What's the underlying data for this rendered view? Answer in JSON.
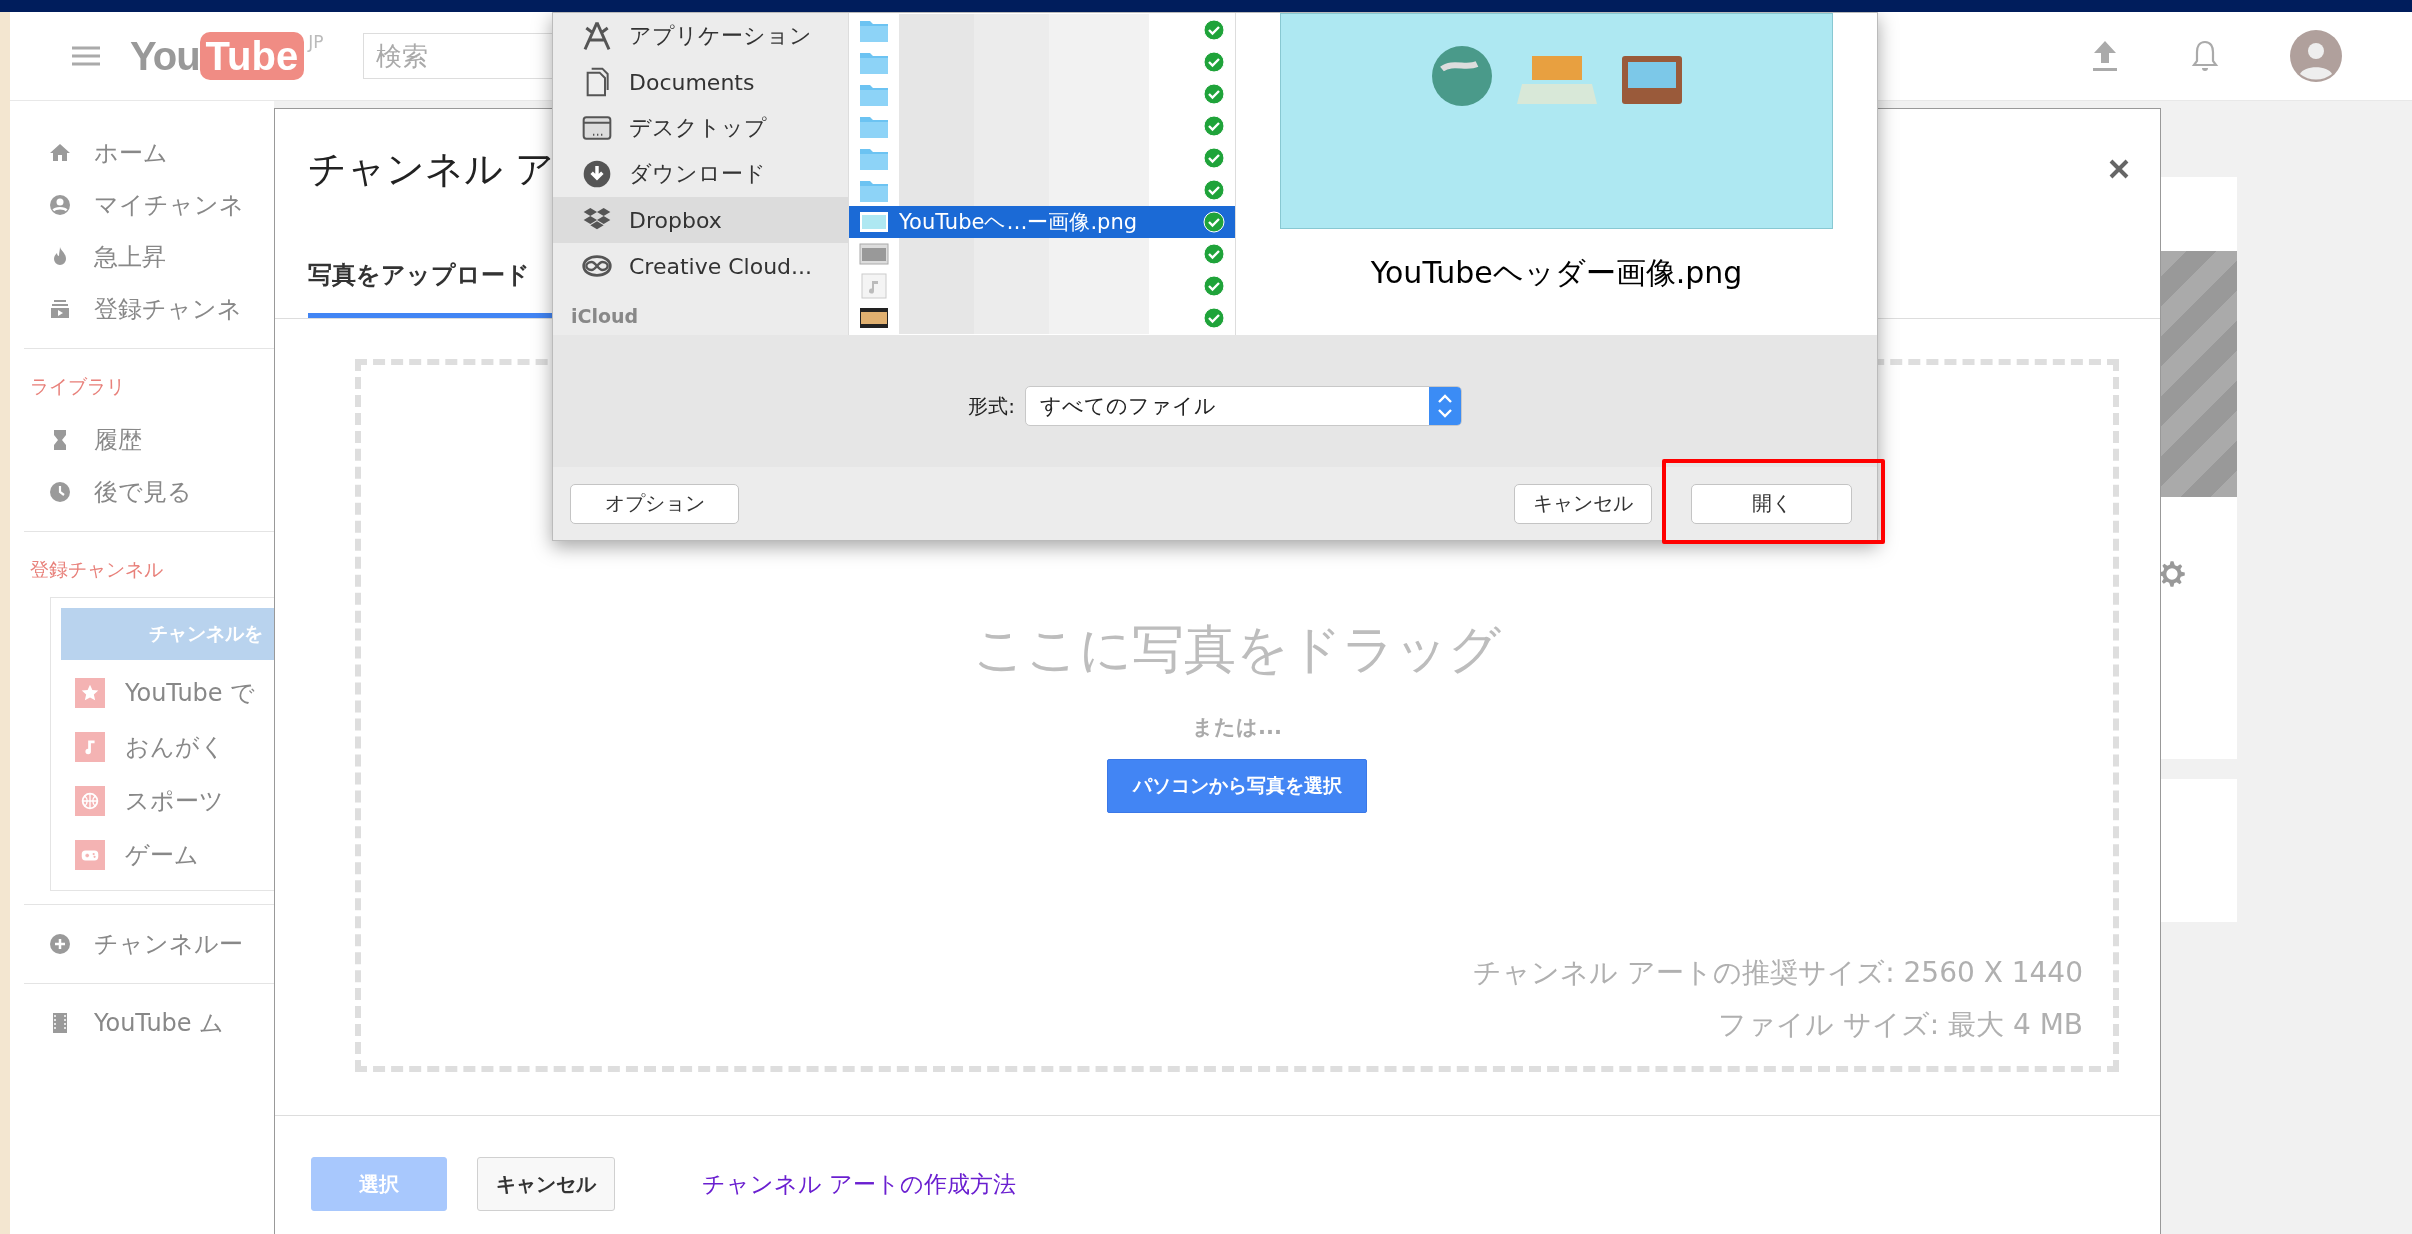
{
  "header": {
    "logo_left": "You",
    "logo_right": "Tube",
    "region": "JP",
    "search": {
      "placeholder": "検索"
    }
  },
  "sidebar": {
    "main": [
      {
        "label": "ホーム"
      },
      {
        "label": "マイチャンネ"
      },
      {
        "label": "急上昇"
      },
      {
        "label": "登録チャンネ"
      }
    ],
    "library": {
      "heading": "ライブラリ",
      "items": [
        {
          "label": "履歴"
        },
        {
          "label": "後で見る"
        }
      ]
    },
    "subscriptions": {
      "heading": "登録チャンネル",
      "browse_button": "チャンネルを",
      "items": [
        {
          "label": "YouTube で"
        },
        {
          "label": "おんがく"
        },
        {
          "label": "スポーツ"
        },
        {
          "label": "ゲーム"
        }
      ]
    },
    "more": [
      {
        "label": "チャンネルー"
      }
    ],
    "footer": [
      {
        "label": "YouTube ム"
      }
    ]
  },
  "modal": {
    "title": "チャンネル ア",
    "tabs": [
      {
        "label": "写真をアップロード",
        "selected": true
      }
    ],
    "drop_zone": {
      "headline": "ここに写真をドラッグ",
      "or": "または...",
      "choose_button": "パソコンから写真を選択",
      "notes": [
        "チャンネル アートの推奨サイズ: 2560 X 1440",
        "ファイル サイズ: 最大 4 MB"
      ]
    },
    "footer": {
      "select_button": {
        "label": "選択",
        "disabled": true
      },
      "cancel_button": "キャンセル",
      "help_link": "チャンネル アートの作成方法"
    }
  },
  "file_dialog": {
    "sidebar": [
      {
        "label": "アプリケーション",
        "selected": false
      },
      {
        "label": "Documents",
        "selected": false
      },
      {
        "label": "デスクトップ",
        "selected": false
      },
      {
        "label": "ダウンロード",
        "selected": false
      },
      {
        "label": "Dropbox",
        "selected": true
      },
      {
        "label": "Creative Cloud...",
        "selected": false
      }
    ],
    "section": "iCloud",
    "files": [
      {
        "kind": "folder",
        "selected": false,
        "synced": true
      },
      {
        "kind": "folder",
        "selected": false,
        "synced": true
      },
      {
        "kind": "folder",
        "selected": false,
        "synced": true
      },
      {
        "kind": "folder",
        "selected": false,
        "synced": true
      },
      {
        "kind": "folder",
        "selected": false,
        "synced": true
      },
      {
        "kind": "folder",
        "selected": false,
        "synced": true
      },
      {
        "kind": "image",
        "name": "YouTubeヘ…ー画像.png",
        "selected": true,
        "synced": true
      },
      {
        "kind": "screen",
        "selected": false,
        "synced": true
      },
      {
        "kind": "audio",
        "selected": false,
        "synced": true
      },
      {
        "kind": "photo",
        "selected": false,
        "synced": true
      }
    ],
    "preview": {
      "filename": "YouTubeヘッダー画像.png"
    },
    "format": {
      "label": "形式:",
      "value": "すべてのファイル"
    },
    "buttons": {
      "options": "オプション",
      "cancel": "キャンセル",
      "open": {
        "label": "開く",
        "annotated": true
      }
    }
  }
}
